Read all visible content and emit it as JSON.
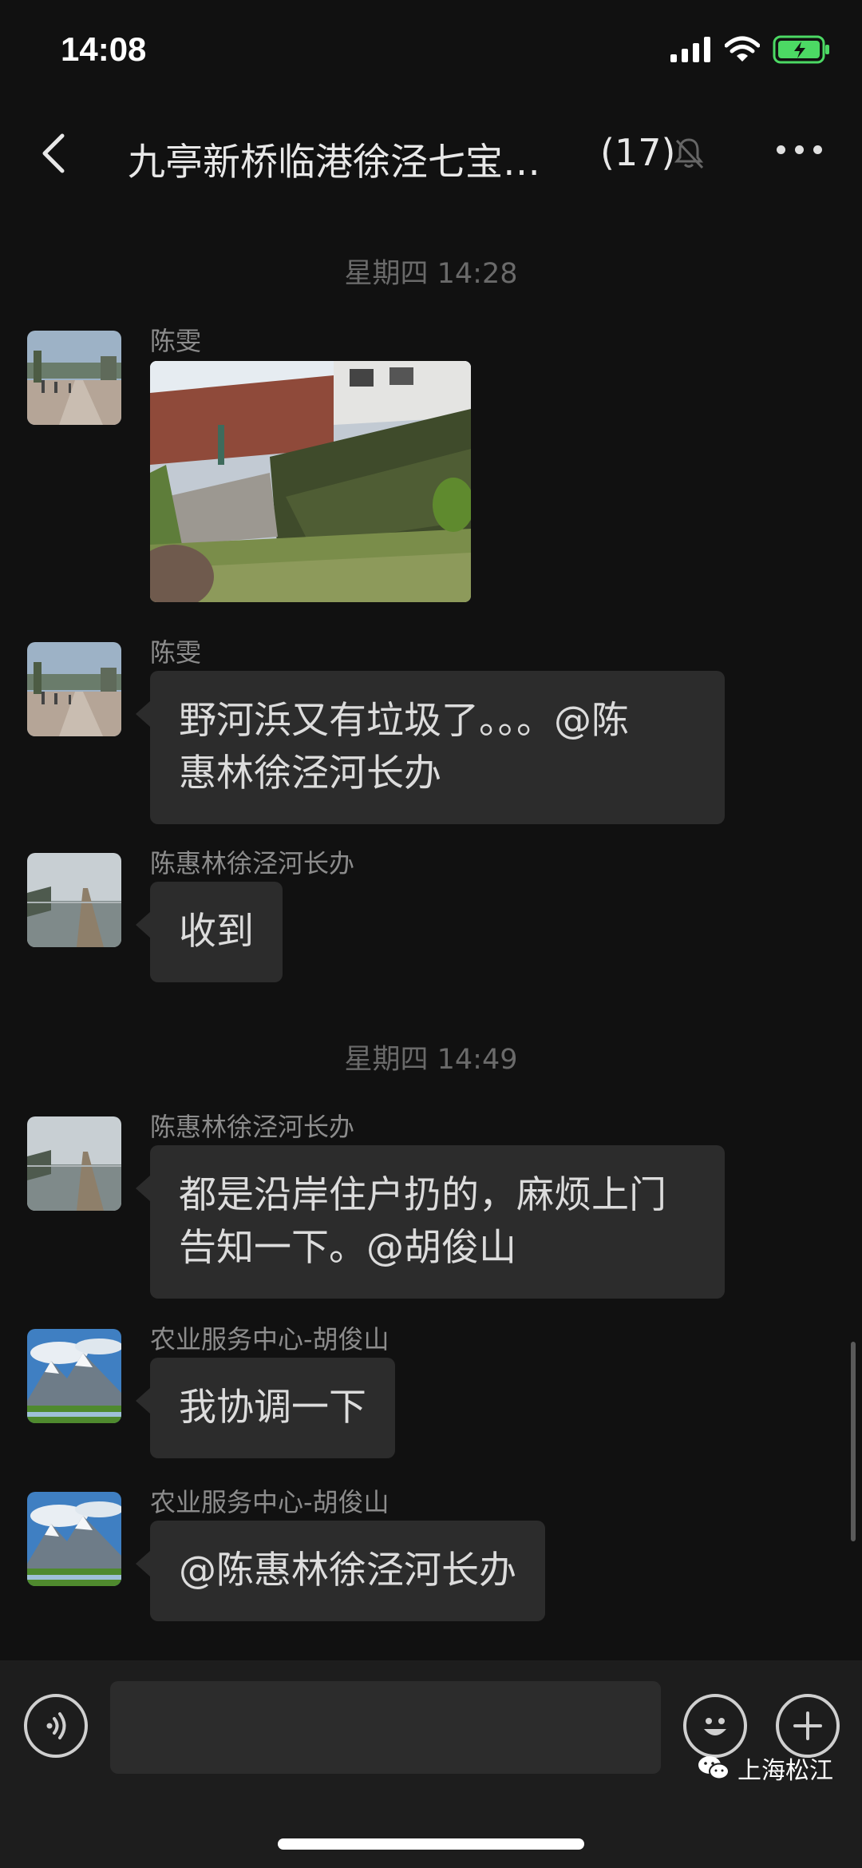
{
  "status_bar": {
    "time": "14:08"
  },
  "header": {
    "title": "九亭新桥临港徐泾七宝…",
    "member_count": "(17)"
  },
  "messages": [
    {
      "type": "timestamp",
      "text": "星期四 14:28"
    },
    {
      "type": "image",
      "sender": "陈雯"
    },
    {
      "type": "text",
      "sender": "陈雯",
      "lines": [
        "野河浜又有垃圾了。。。@陈",
        "惠林徐泾河长办"
      ]
    },
    {
      "type": "text",
      "sender": "陈惠林徐泾河长办",
      "lines": [
        "收到"
      ]
    },
    {
      "type": "timestamp",
      "text": "星期四 14:49"
    },
    {
      "type": "text",
      "sender": "陈惠林徐泾河长办",
      "lines": [
        "都是沿岸住户扔的，麻烦上门",
        "告知一下。@胡俊山"
      ]
    },
    {
      "type": "text",
      "sender": "农业服务中心-胡俊山",
      "lines": [
        "我协调一下"
      ]
    },
    {
      "type": "text",
      "sender": "农业服务中心-胡俊山",
      "lines": [
        "@陈惠林徐泾河长办"
      ]
    }
  ],
  "watermark": {
    "text": "上海松江"
  },
  "colors": {
    "background": "#111111",
    "bubble": "#2c2c2c",
    "battery": "#4cd964"
  }
}
